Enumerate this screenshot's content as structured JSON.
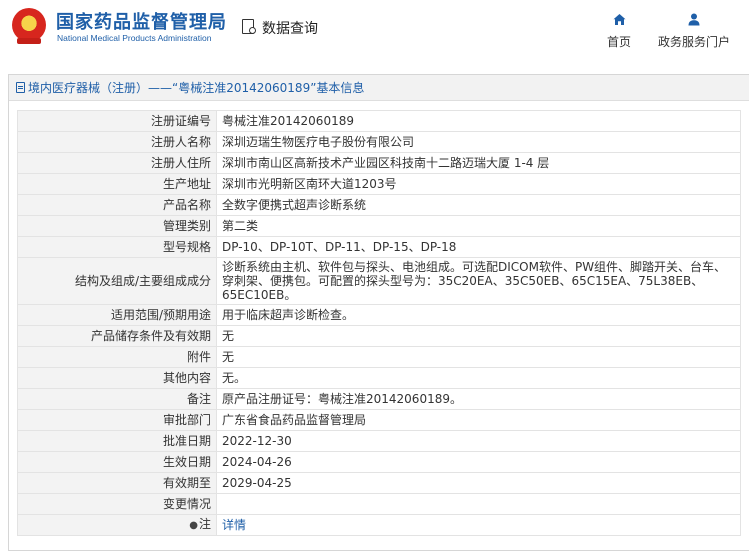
{
  "header": {
    "brand_cn": "国家药品监督管理局",
    "brand_en": "National Medical Products Administration",
    "query_label": "数据查询",
    "nav": [
      {
        "label": "首页",
        "icon": "home-icon"
      },
      {
        "label": "政务服务门户",
        "icon": "user-icon"
      }
    ]
  },
  "info": {
    "heading": "境内医疗器械（注册）——“粤械注准20142060189”基本信息",
    "rows": [
      {
        "label": "注册证编号",
        "value": "粤械注准20142060189"
      },
      {
        "label": "注册人名称",
        "value": "深圳迈瑞生物医疗电子股份有限公司"
      },
      {
        "label": "注册人住所",
        "value": "深圳市南山区高新技术产业园区科技南十二路迈瑞大厦 1-4 层"
      },
      {
        "label": "生产地址",
        "value": "深圳市光明新区南环大道1203号"
      },
      {
        "label": "产品名称",
        "value": "全数字便携式超声诊断系统"
      },
      {
        "label": "管理类别",
        "value": "第二类"
      },
      {
        "label": "型号规格",
        "value": "DP-10、DP-10T、DP-11、DP-15、DP-18"
      },
      {
        "label": "结构及组成/主要组成成分",
        "value": "诊断系统由主机、软件包与探头、电池组成。可选配DICOM软件、PW组件、脚踏开关、台车、穿刺架、便携包。可配置的探头型号为：35C20EA、35C50EB、65C15EA、75L38EB、65EC10EB。"
      },
      {
        "label": "适用范围/预期用途",
        "value": "用于临床超声诊断检查。"
      },
      {
        "label": "产品储存条件及有效期",
        "value": "无"
      },
      {
        "label": "附件",
        "value": "无"
      },
      {
        "label": "其他内容",
        "value": "无。"
      },
      {
        "label": "备注",
        "value": "原产品注册证号：粤械注准20142060189。"
      },
      {
        "label": "审批部门",
        "value": "广东省食品药品监督管理局"
      },
      {
        "label": "批准日期",
        "value": "2022-12-30"
      },
      {
        "label": "生效日期",
        "value": "2024-04-26"
      },
      {
        "label": "有效期至",
        "value": "2029-04-25"
      },
      {
        "label": "变更情况",
        "value": ""
      }
    ],
    "note_label": "注",
    "note_link": "详情"
  },
  "colors": {
    "brand": "#1f5fa8",
    "emblem_red": "#d7261e",
    "emblem_gold": "#f6d34a"
  }
}
